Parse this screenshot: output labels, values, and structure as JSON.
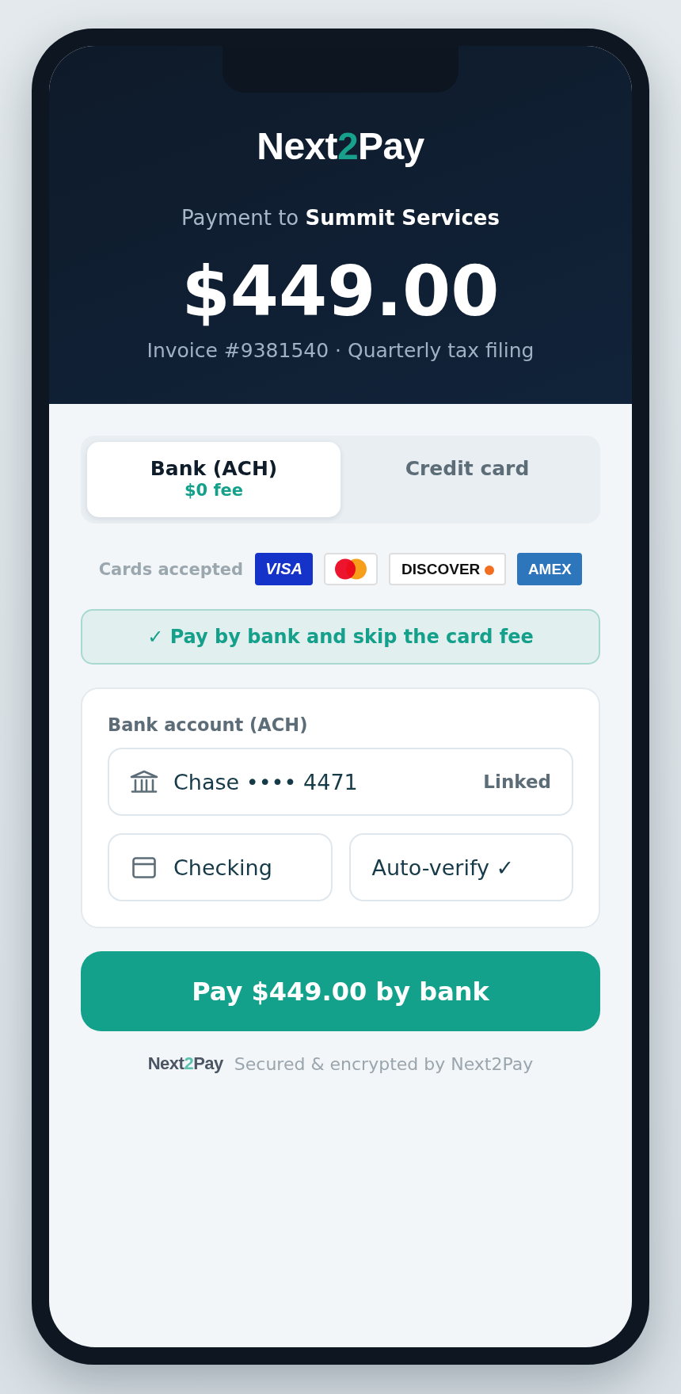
{
  "logo": {
    "parts": [
      {
        "text": "Next",
        "accent": false
      },
      {
        "text": "2",
        "accent": true
      },
      {
        "text": "Pay",
        "accent": false
      }
    ]
  },
  "payee": "Payment to **Summit Services**",
  "amount": "$449.00",
  "invoice": "Invoice #9381540 · Quarterly tax filing",
  "tabs": [
    {
      "label": "Bank (ACH)",
      "note": "$0 fee",
      "selected": true
    },
    {
      "label": "Credit card",
      "selected": false
    }
  ],
  "cards_accepted": {
    "label": "Cards accepted",
    "brands": [
      {
        "kind": "visa",
        "label": "VISA"
      },
      {
        "kind": "mastercard"
      },
      {
        "kind": "discover",
        "label": "DISCOVER"
      },
      {
        "kind": "amex",
        "label": "AMEX"
      }
    ]
  },
  "notice": "✓ Pay by bank and skip the card fee",
  "bank_account": {
    "label": "Bank account (ACH)",
    "account": {
      "value": "Chase •••• 4471",
      "status": "Linked"
    },
    "account_type": {
      "value": "Checking"
    },
    "verification": {
      "value": "Auto-verify ✓"
    }
  },
  "pay_button": "Pay $449.00 by bank",
  "footer": {
    "logo": {
      "parts": [
        {
          "text": "Next",
          "accent": false
        },
        {
          "text": "2",
          "accent": true
        },
        {
          "text": "Pay",
          "accent": false
        }
      ]
    },
    "text": "Secured & encrypted by Next2Pay"
  }
}
